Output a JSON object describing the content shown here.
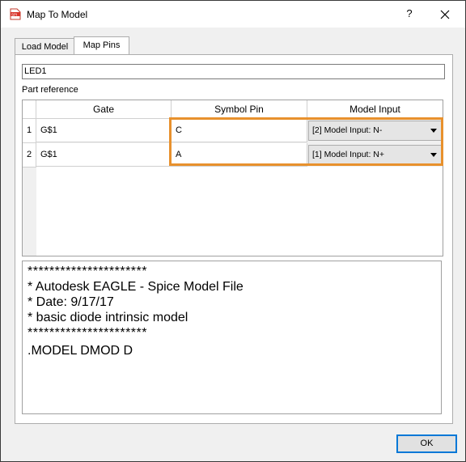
{
  "window": {
    "title": "Map To Model",
    "help_label": "?",
    "close_label": "×"
  },
  "tabs": [
    {
      "label": "Load Model"
    },
    {
      "label": "Map Pins"
    }
  ],
  "part_reference": {
    "value": "LED1",
    "label": "Part reference"
  },
  "table": {
    "headers": [
      "Gate",
      "Symbol Pin",
      "Model Input"
    ],
    "rows": [
      {
        "num": "1",
        "gate": "G$1",
        "symbol_pin": "C",
        "model_input": "[2] Model Input: N-"
      },
      {
        "num": "2",
        "gate": "G$1",
        "symbol_pin": "A",
        "model_input": "[1] Model Input: N+"
      }
    ]
  },
  "model_text": {
    "lines": [
      "**********************",
      "* Autodesk EAGLE - Spice Model File",
      "* Date: 9/17/17",
      "* basic diode intrinsic model",
      "**********************",
      ".MODEL DMOD D"
    ]
  },
  "buttons": {
    "ok": "OK"
  },
  "colors": {
    "highlight": "#e8912d",
    "ok_border": "#0078d7"
  },
  "icons": {
    "app": "spice-file-icon"
  }
}
